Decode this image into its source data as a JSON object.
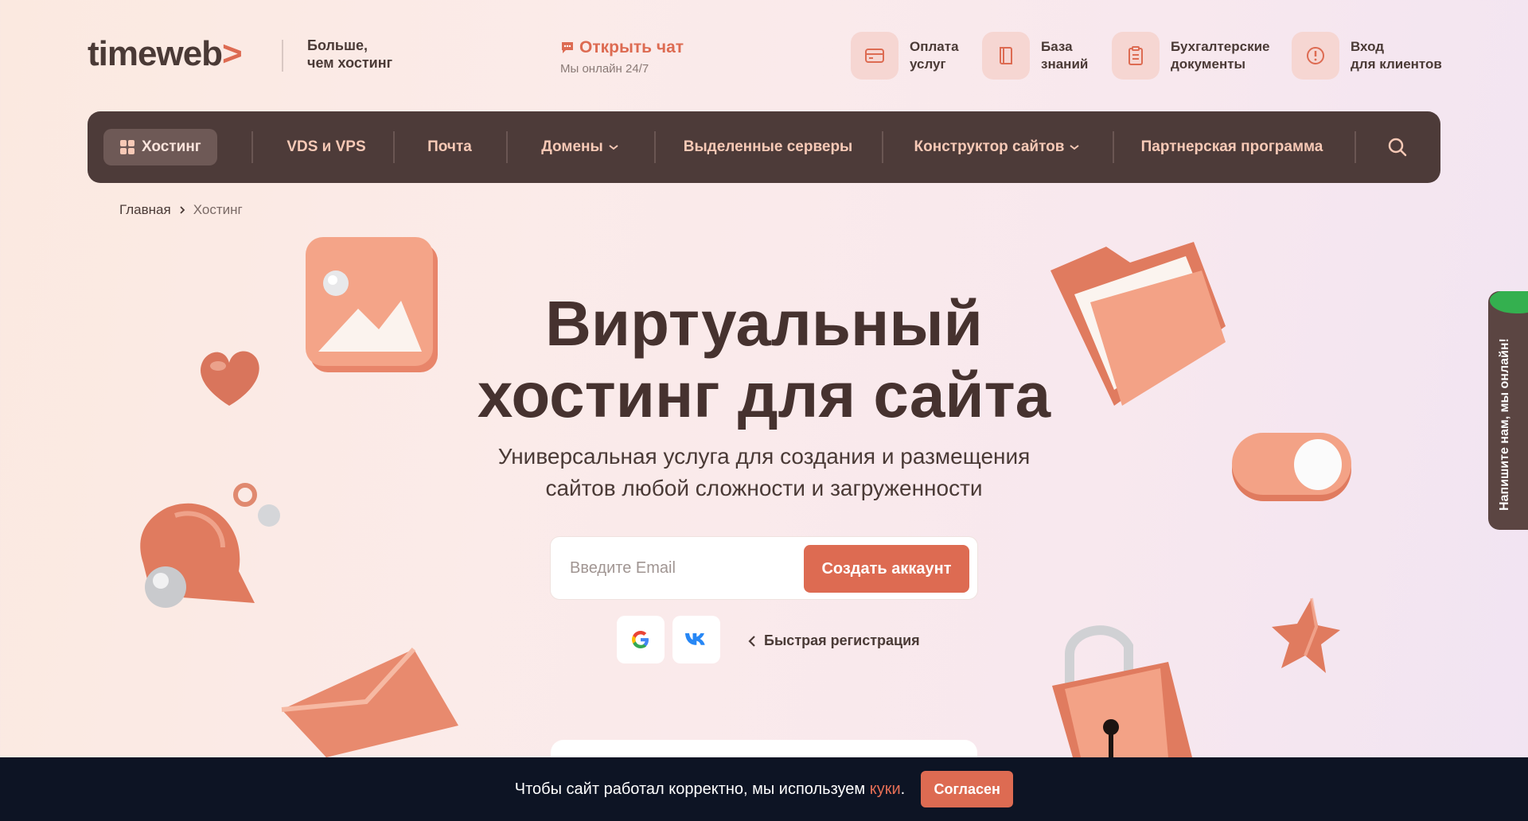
{
  "header": {
    "logo_text": "timeweb",
    "logo_arrow": ">",
    "tagline_line1": "Больше,",
    "tagline_line2": "чем хостинг",
    "chat": {
      "label": "Открыть чат",
      "sub": "Мы онлайн 24/7"
    },
    "links": [
      {
        "line1": "Оплата",
        "line2": "услуг",
        "icon": "card-icon"
      },
      {
        "line1": "База",
        "line2": "знаний",
        "icon": "book-icon"
      },
      {
        "line1": "Бухгалтерские",
        "line2": "документы",
        "icon": "clipboard-icon"
      },
      {
        "line1": "Вход",
        "line2": "для клиентов",
        "icon": "login-icon"
      }
    ]
  },
  "nav": {
    "items": [
      {
        "label": "Хостинг",
        "active": true
      },
      {
        "label": "VDS и VPS"
      },
      {
        "label": "Почта"
      },
      {
        "label": "Домены",
        "dropdown": true
      },
      {
        "label": "Выделенные серверы"
      },
      {
        "label": "Конструктор сайтов",
        "dropdown": true
      },
      {
        "label": "Партнерская программа"
      }
    ],
    "search_icon": "search-icon"
  },
  "breadcrumb": {
    "home": "Главная",
    "current": "Хостинг"
  },
  "hero": {
    "title_line1": "Виртуальный",
    "title_line2": "хостинг для сайта",
    "subtitle_line1": "Универсальная услуга для создания и размещения",
    "subtitle_line2": "сайтов любой сложности и загруженности",
    "email_placeholder": "Введите Email",
    "cta_label": "Создать аккаунт",
    "quick_reg": "Быстрая регистрация"
  },
  "side_widget": {
    "text": "Напишите нам, мы онлайн!"
  },
  "cookie": {
    "text_before": "Чтобы сайт работал корректно, мы используем ",
    "link": "куки",
    "text_after": ".",
    "button": "Согласен"
  },
  "colors": {
    "accent": "#dd6b52",
    "nav_bg": "#4d3b39",
    "nav_text": "#f7c9b6",
    "cookie_bg": "#0d1424"
  }
}
